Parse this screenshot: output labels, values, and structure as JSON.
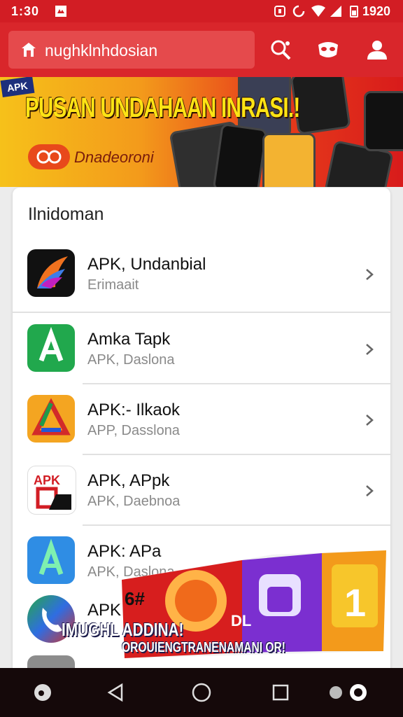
{
  "status_bar": {
    "time": "1:30",
    "right_time": "1920"
  },
  "address_bar": {
    "url": "nughklnhdosian"
  },
  "banner": {
    "tag": "APK",
    "headline": "PUSAN UNDAHAAN INRASI.!",
    "brand_text": "Dnadeoroni"
  },
  "card": {
    "title": "Ilnidoman",
    "apps": [
      {
        "name": "APK, Undanbial",
        "subtitle": "Erimaait",
        "icon": "colorful-wing-icon"
      },
      {
        "name": "Amka Tapk",
        "subtitle": "APK, Daslona",
        "icon": "green-a-icon"
      },
      {
        "name": "APK:- Ilkaok",
        "subtitle": "APP, Dasslona",
        "icon": "triangle-icon"
      },
      {
        "name": "APK, APpk",
        "subtitle": "APK, Daebnoa",
        "icon": "apk-logo-icon"
      },
      {
        "name": "APK: APa",
        "subtitle": "APK, Daslona",
        "icon": "blue-a-icon"
      },
      {
        "name": "APK",
        "subtitle": "",
        "icon": "phone-icon"
      }
    ]
  },
  "ad_overlay": {
    "badge": "6#",
    "line1": "IMUGHL ADDINA!",
    "line2": "OROUIENGTRANENAMANI OR!",
    "letter": "DL"
  }
}
